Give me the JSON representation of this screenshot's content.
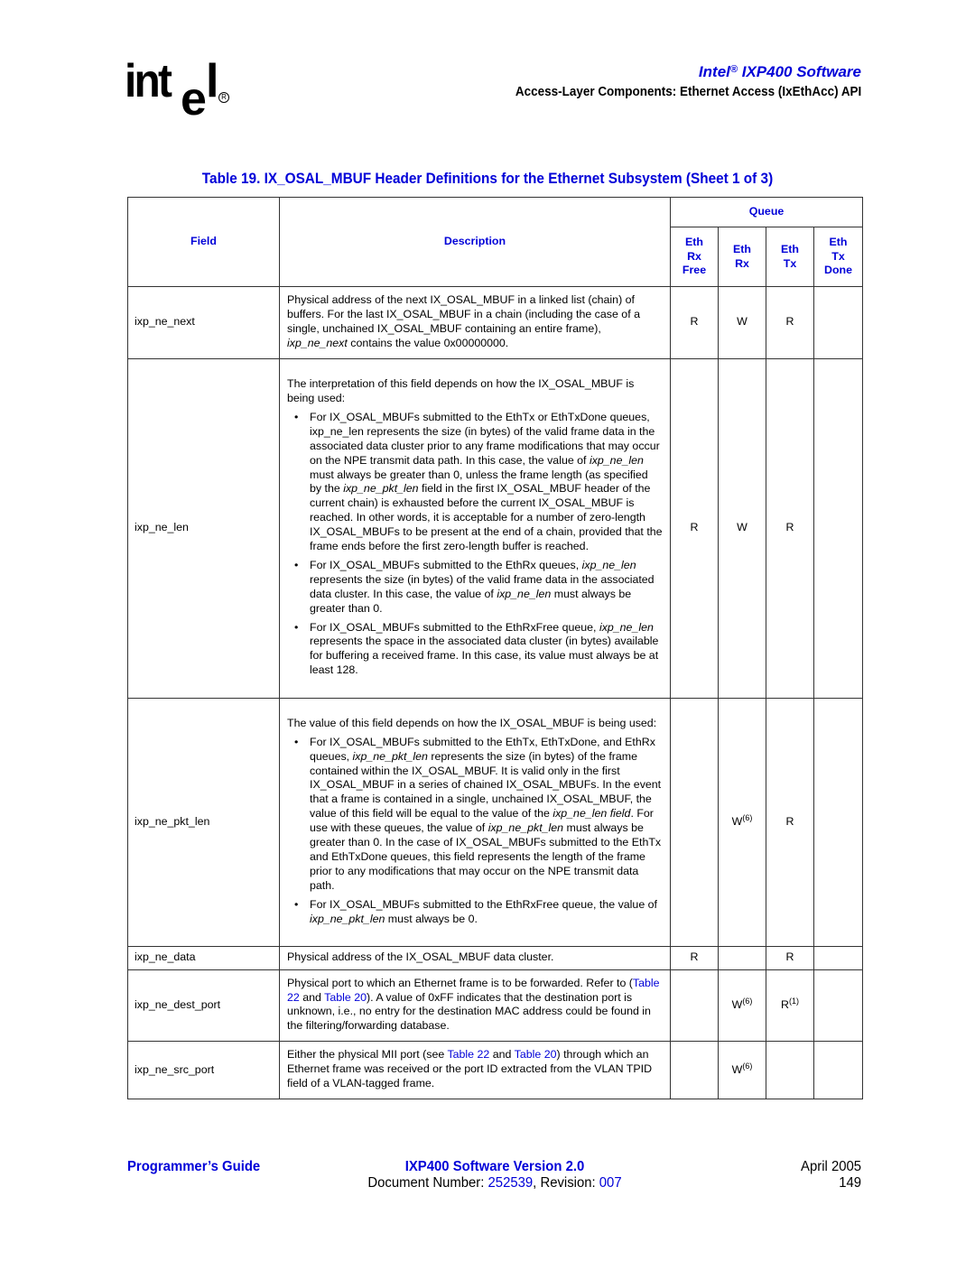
{
  "header": {
    "logo_text": "intel",
    "product_prefix": "Intel",
    "product_reg": "®",
    "product_name": "IXP400 Software",
    "section_title": "Access-Layer Components: Ethernet Access (IxEthAcc) API"
  },
  "table": {
    "caption": "Table 19.  IX_OSAL_MBUF Header Definitions for the Ethernet Subsystem (Sheet 1 of 3)",
    "headers": {
      "field": "Field",
      "description": "Description",
      "queue_group": "Queue",
      "queues": [
        {
          "lines": [
            "Eth",
            "Rx",
            "Free"
          ]
        },
        {
          "lines": [
            "Eth",
            "Rx"
          ]
        },
        {
          "lines": [
            "Eth",
            "Tx"
          ]
        },
        {
          "lines": [
            "Eth",
            "Tx",
            "Done"
          ]
        }
      ]
    },
    "rows": [
      {
        "field": "ixp_ne_next",
        "desc_parts": [
          "Physical address of the next IX_OSAL_MBUF in a linked list (chain) of buffers. For the last IX_OSAL_MBUF in a chain (including the case of a single, unchained IX_OSAL_MBUF containing an entire frame), ",
          "ixp_ne_next",
          " contains the value 0x00000000."
        ],
        "queues": [
          "R",
          "W",
          "R",
          ""
        ]
      },
      {
        "field": "ixp_ne_len",
        "intro": "The interpretation of this field depends on how the IX_OSAL_MBUF is being used:",
        "bullets": [
          {
            "parts": [
              "For IX_OSAL_MBUFs submitted to the EthTx or EthTxDone queues, ixp_ne_len represents the size (in bytes) of the valid frame data in the associated data cluster prior to any frame modifications that may occur on the NPE transmit data path. In this case, the value of ",
              "ixp_ne_len",
              " must always be greater than 0, unless the frame length (as specified by the ",
              "ixp_ne_pkt_len",
              " field in the first IX_OSAL_MBUF header of the current chain) is exhausted before the current IX_OSAL_MBUF is reached. In other words, it is acceptable for a number of zero-length IX_OSAL_MBUFs to be present at the end of a chain, provided that the frame ends before the first zero-length buffer is reached."
            ]
          },
          {
            "parts": [
              "For IX_OSAL_MBUFs submitted to the EthRx queues, ",
              "ixp_ne_len",
              " represents the size (in bytes) of the valid frame data in the associated data cluster. In this case, the value of ",
              "ixp_ne_len",
              " must always be greater than 0."
            ]
          },
          {
            "parts": [
              "For IX_OSAL_MBUFs submitted to the EthRxFree queue, ",
              "ixp_ne_len",
              " represents the space in the associated data cluster (in bytes) available for buffering a received frame. In this case, its value must always be at least 128."
            ]
          }
        ],
        "queues": [
          "R",
          "W",
          "R",
          ""
        ]
      },
      {
        "field": "ixp_ne_pkt_len",
        "intro": "The value of this field depends on how the IX_OSAL_MBUF is being used:",
        "bullets": [
          {
            "parts": [
              "For IX_OSAL_MBUFs submitted to the EthTx, EthTxDone, and EthRx queues, ",
              "ixp_ne_pkt_len",
              " represents the size (in bytes) of the frame contained within the IX_OSAL_MBUF. It is valid only in the first IX_OSAL_MBUF in a series of chained IX_OSAL_MBUFs. In the event that a frame is contained in a single, unchained IX_OSAL_MBUF, the value of this field will be equal to the value of the ",
              "ixp_ne_len field",
              ". For use with these queues, the value of ",
              "ixp_ne_pkt_len",
              " must always be greater than 0. In the case of IX_OSAL_MBUFs submitted to the EthTx and EthTxDone queues, this field represents the length of the frame prior to any modifications that may occur on the NPE transmit data path."
            ]
          },
          {
            "parts": [
              "For IX_OSAL_MBUFs submitted to the EthRxFree queue, the value of ",
              "ixp_ne_pkt_len",
              " must always be 0."
            ]
          }
        ],
        "queues": [
          "",
          "W",
          "R",
          ""
        ],
        "queue_notes": [
          "",
          "(6)",
          "",
          ""
        ]
      },
      {
        "field": "ixp_ne_data",
        "desc": "Physical address of the IX_OSAL_MBUF data cluster.",
        "queues": [
          "R",
          "",
          "R",
          ""
        ]
      },
      {
        "field": "ixp_ne_dest_port",
        "desc_parts": [
          "Physical port to which an Ethernet frame is to be forwarded. Refer to (",
          "Table 22",
          " and ",
          "Table 20",
          "). A value of 0xFF indicates that the destination port is unknown, i.e., no entry for the destination MAC address could be found in the filtering/forwarding database."
        ],
        "queues": [
          "",
          "W",
          "R",
          ""
        ],
        "queue_notes": [
          "",
          "(6)",
          "(1)",
          ""
        ]
      },
      {
        "field": "ixp_ne_src_port",
        "desc_parts": [
          "Either the physical MII port (see ",
          "Table 22",
          " and ",
          "Table 20",
          ") through which an Ethernet frame was received or the port ID extracted from the VLAN TPID field of a VLAN-tagged frame."
        ],
        "queues": [
          "",
          "W",
          "",
          ""
        ],
        "queue_notes": [
          "",
          "(6)",
          "",
          ""
        ]
      }
    ]
  },
  "footer": {
    "guide": "Programmer’s Guide",
    "version": "IXP400 Software Version 2.0",
    "docnum_label": "Document Number: ",
    "docnum": "252539",
    "revision_label": ", Revision: ",
    "revision": "007",
    "date": "April 2005",
    "page": "149"
  },
  "colors": {
    "accent": "#0000d8",
    "border": "#333333"
  }
}
